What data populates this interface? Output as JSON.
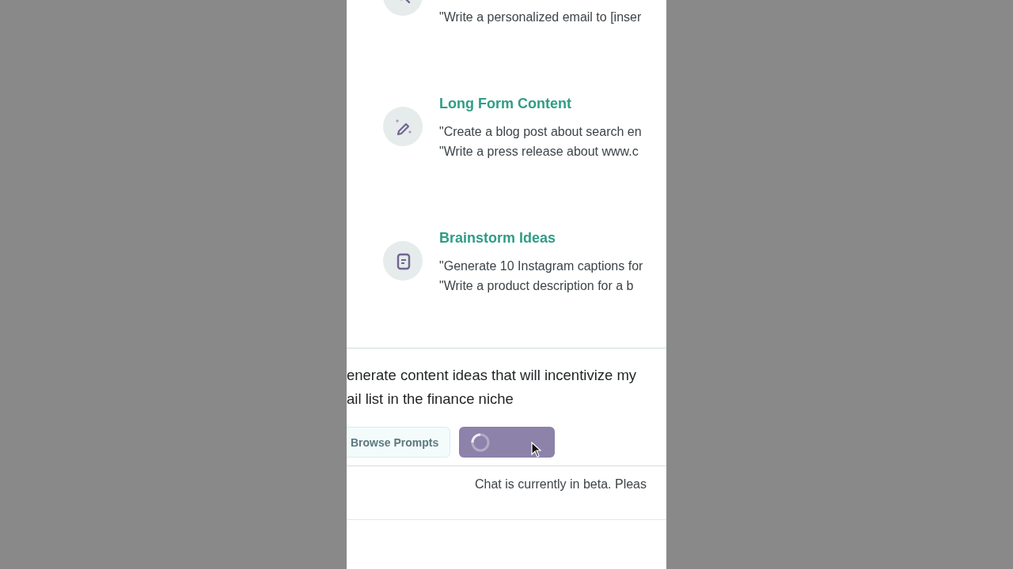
{
  "prompt_groups": [
    {
      "examples": [
        "\"Write a personalized email to [inser"
      ]
    },
    {
      "title": "Long Form Content",
      "examples": [
        "\"Create a blog post about search en",
        "\"Write a press release about www.c"
      ]
    },
    {
      "title": "Brainstorm Ideas",
      "examples": [
        "\"Generate 10 Instagram captions for",
        "\"Write a product description for a b"
      ]
    }
  ],
  "composer": {
    "lines": [
      "enerate content ideas that will incentivize my",
      "ail list in the finance niche"
    ],
    "browse_button": "Browse Prompts",
    "submit_button": {
      "busy": true
    }
  },
  "footer": {
    "notice": "Chat is currently in beta. Pleas"
  }
}
